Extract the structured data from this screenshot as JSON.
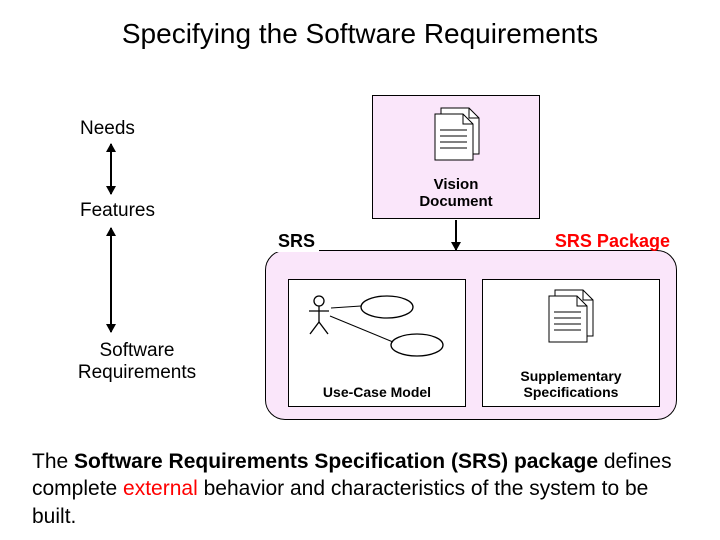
{
  "title": "Specifying the Software Requirements",
  "labels": {
    "needs": "Needs",
    "features": "Features",
    "software_requirements": "Software\nRequirements"
  },
  "vision": {
    "caption": "Vision\nDocument"
  },
  "srs": {
    "label": "SRS",
    "package_label": "SRS Package",
    "usecase_caption": "Use-Case Model",
    "supplementary_caption": "Supplementary\nSpecifications"
  },
  "body": {
    "pre": "The ",
    "bold": "Software Requirements Specification (SRS) package",
    "mid": " defines complete ",
    "external": "external",
    "post": " behavior and characteristics of the system to be built."
  }
}
